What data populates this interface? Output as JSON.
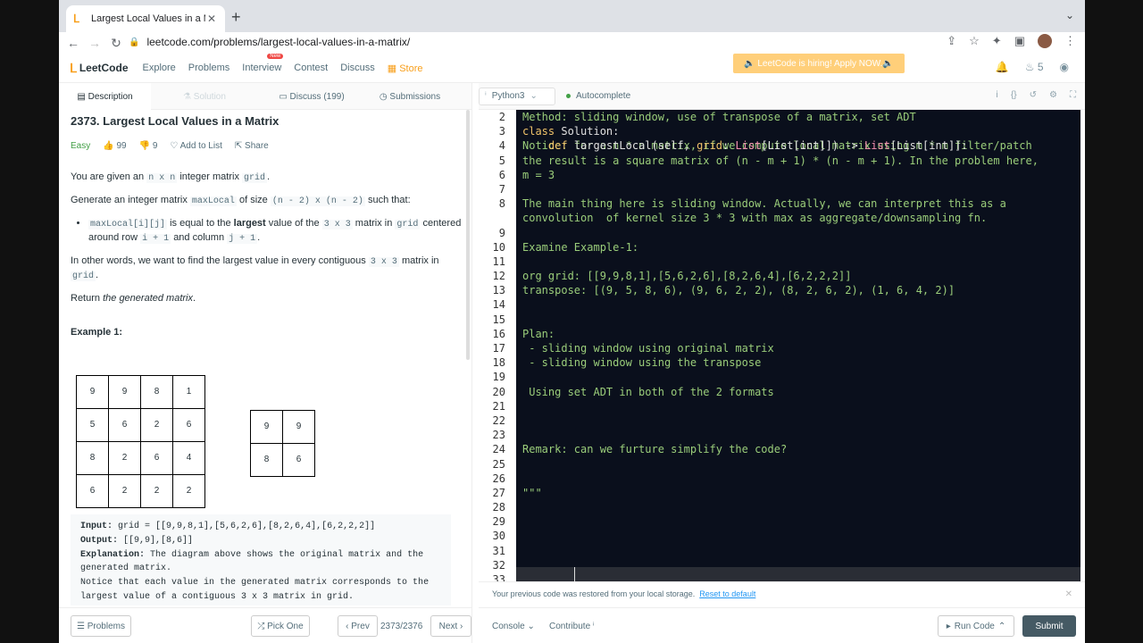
{
  "browser": {
    "tab_title": "Largest Local Values in a Matri",
    "url": "leetcode.com/problems/largest-local-values-in-a-matrix/"
  },
  "nav": {
    "logo": "LeetCode",
    "links": [
      "Explore",
      "Problems",
      "Interview",
      "Contest",
      "Discuss"
    ],
    "new_badge": "New",
    "store": "Store",
    "hiring": "🔈 LeetCode is hiring! Apply NOW.🔈",
    "streak": "5"
  },
  "left_tabs": [
    "Description",
    "Solution",
    "Discuss (199)",
    "Submissions"
  ],
  "problem": {
    "title": "2373. Largest Local Values in a Matrix",
    "difficulty": "Easy",
    "likes": "99",
    "dislikes": "9",
    "add_to_list": "Add to List",
    "share": "Share",
    "p1_pre": "You are given an",
    "p1_code1": "n x n",
    "p1_mid": "integer matrix",
    "p1_code2": "grid",
    "p2_pre": "Generate an integer matrix",
    "p2_code1": "maxLocal",
    "p2_mid": "of size",
    "p2_code2": "(n - 2) x (n - 2)",
    "p2_post": "such that:",
    "bullet_code1": "maxLocal[i][j]",
    "bullet_t1": "is equal to the",
    "bullet_bold": "largest",
    "bullet_t2": "value of the",
    "bullet_code2": "3 x 3",
    "bullet_t3": "matrix in",
    "bullet_code3": "grid",
    "bullet_t4": "centered around row",
    "bullet_code4": "i + 1",
    "bullet_t5": "and column",
    "bullet_code5": "j + 1",
    "p3_pre": "In other words, we want to find the largest value in every contiguous",
    "p3_code1": "3 x 3",
    "p3_mid": "matrix in",
    "p3_code2": "grid",
    "p4_pre": "Return",
    "p4_em": "the generated matrix",
    "example_title": "Example 1:",
    "grid": [
      [
        "9",
        "9",
        "8",
        "1"
      ],
      [
        "5",
        "6",
        "2",
        "6"
      ],
      [
        "8",
        "2",
        "6",
        "4"
      ],
      [
        "6",
        "2",
        "2",
        "2"
      ]
    ],
    "result": [
      [
        "9",
        "9"
      ],
      [
        "8",
        "6"
      ]
    ],
    "ex_input_label": "Input:",
    "ex_input": "grid = [[9,9,8,1],[5,6,2,6],[8,2,6,4],[6,2,2,2]]",
    "ex_output_label": "Output:",
    "ex_output": "[[9,9],[8,6]]",
    "ex_expl_label": "Explanation:",
    "ex_expl1": "The diagram above shows the original matrix and the",
    "ex_expl2": "generated matrix.",
    "ex_expl3": "Notice that each value in the generated matrix corresponds to the",
    "ex_expl4": "largest value of a contiguous 3 x 3 matrix in grid."
  },
  "left_footer": {
    "problems": "Problems",
    "pick_one": "Pick One",
    "prev": "Prev",
    "counter": "2373/2376",
    "next": "Next"
  },
  "editor": {
    "language": "Python3",
    "autocomplete": "Autocomplete",
    "line_numbers": [
      "2",
      "3",
      "4",
      "5",
      "6",
      "7",
      "8",
      "",
      "9",
      "10",
      "11",
      "12",
      "13",
      "14",
      "15",
      "16",
      "17",
      "18",
      "19",
      "20",
      "21",
      "22",
      "23",
      "24",
      "25",
      "26",
      "27",
      "28",
      "29",
      "30",
      "31",
      "32",
      "33"
    ],
    "lines": [
      "Method: sliding window, use of transpose of a matrix, set ADT",
      "",
      "Notice: for a n * n matrix, if we compute local matrix using m * m filter/patch",
      "the result is a square matrix of (n - m + 1) * (n - m + 1). In the problem here,",
      "m = 3",
      "",
      "The main thing here is sliding window. Actually, we can interpret this as a",
      "convolution  of kernel size 3 * 3 with max as aggregate/downsampling fn.",
      "",
      "Examine Example-1:",
      "",
      "org grid: [[9,9,8,1],[5,6,2,6],[8,2,6,4],[6,2,2,2]]",
      "transpose: [(9, 5, 8, 6), (9, 6, 2, 2), (8, 2, 6, 2), (1, 6, 4, 2)]",
      "",
      "",
      "Plan:",
      " - sliding window using original matrix",
      " - sliding window using the transpose",
      "",
      " Using set ADT in both of the 2 formats",
      "",
      "",
      "",
      "Remark: can we furture simplify the code?",
      "",
      "",
      "\"\"\"",
      ""
    ],
    "class_kw": "class",
    "class_name": "Solution:",
    "def_kw": "def",
    "def_name": "largestLocal",
    "def_params_pre": "(self,",
    "def_param": "grid",
    "def_colon": ":",
    "def_type1": "List",
    "def_type1_inner": "[List[int]])",
    "def_arrow": " ->",
    "def_type2": "List",
    "def_type2_inner": "[List[int]]:"
  },
  "restore": {
    "text": "Your previous code was restored from your local storage.",
    "link": "Reset to default"
  },
  "right_footer": {
    "console": "Console",
    "contribute": "Contribute",
    "run_code": "Run Code",
    "submit": "Submit"
  }
}
